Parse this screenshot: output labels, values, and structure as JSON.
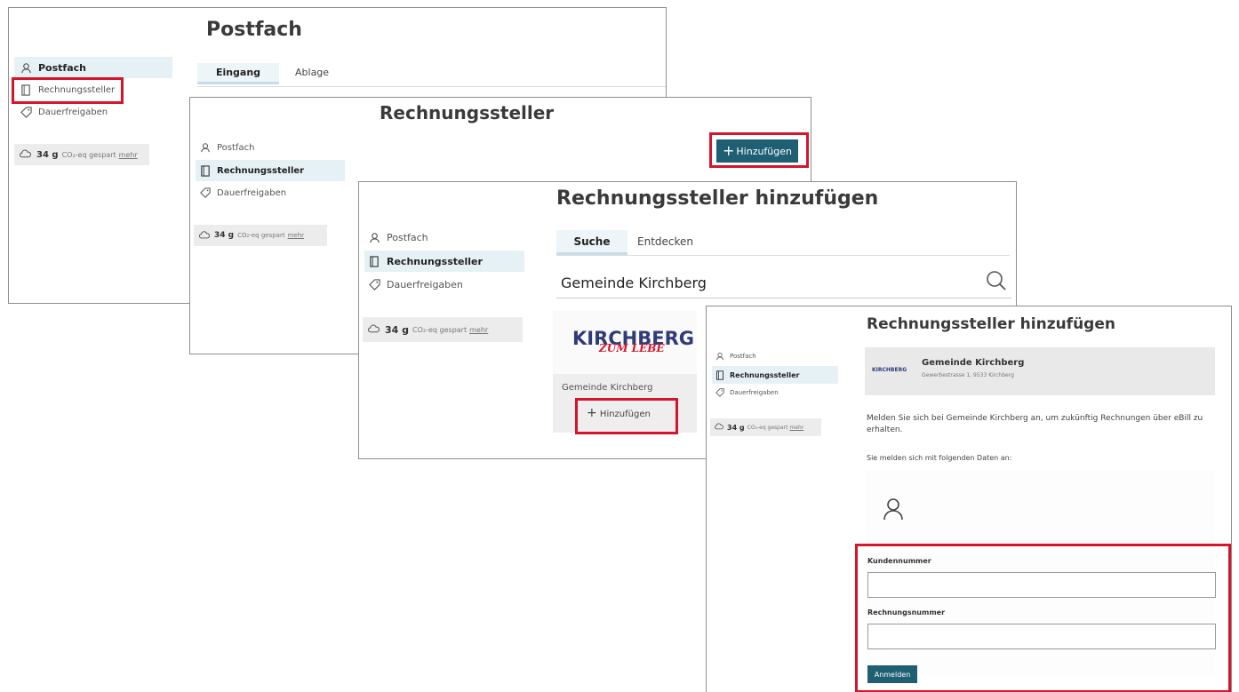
{
  "nav": {
    "postfach": "Postfach",
    "rechnungssteller": "Rechnungssteller",
    "dauerfreigaben": "Dauerfreigaben"
  },
  "co2": {
    "amount": "34 g",
    "text": "CO₂-eq gespart",
    "link": "mehr"
  },
  "screen1": {
    "title": "Postfach",
    "tabs": [
      "Eingang",
      "Ablage"
    ]
  },
  "screen2": {
    "title": "Rechnungssteller",
    "add_button": "Hinzufügen"
  },
  "screen3": {
    "title": "Rechnungssteller hinzufügen",
    "tabs": [
      "Suche",
      "Entdecken"
    ],
    "search_value": "Gemeinde Kirchberg",
    "result_logo_text": "KIRCHBERG",
    "result_logo_tagline": "ZUM LEBE",
    "result_name": "Gemeinde Kirchberg",
    "add_button": "Hinzufügen"
  },
  "screen4": {
    "title": "Rechnungssteller hinzufügen",
    "biller_logo": "KIRCHBERG",
    "biller_name": "Gemeinde Kirchberg",
    "biller_address": "Gewerbestrasse 1, 9533 Kirchberg",
    "intro": "Melden Sie sich bei Gemeinde Kirchberg an, um zukünftig Rechnungen über eBill zu erhalten.",
    "sub": "Sie melden sich mit folgenden Daten an:",
    "field1_label": "Kundennummer",
    "field1_value": "",
    "field2_label": "Rechnungsnummer",
    "field2_value": "",
    "submit": "Anmelden"
  },
  "colors": {
    "accent": "#1f5f73",
    "highlight": "#d5152b",
    "nav_active": "#e6f1f6"
  }
}
